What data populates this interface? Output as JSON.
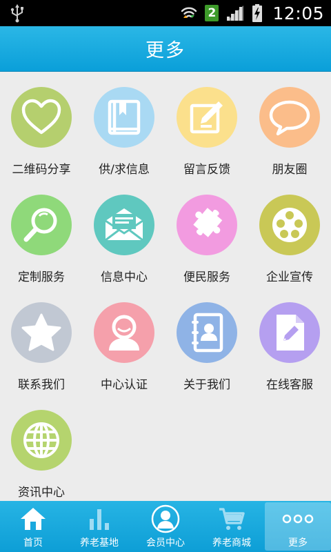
{
  "statusbar": {
    "sim_slot": "2",
    "time": "12:05",
    "icons": [
      "usb-icon",
      "wifi-icon",
      "sim-icon",
      "signal-icon",
      "battery-charging-icon"
    ]
  },
  "header": {
    "title": "更多"
  },
  "grid": {
    "items": [
      {
        "label": "二维码分享",
        "icon": "heart-icon",
        "color": "#b5cf6e"
      },
      {
        "label": "供/求信息",
        "icon": "book-icon",
        "color": "#a9d9f3"
      },
      {
        "label": "留言反馈",
        "icon": "edit-note-icon",
        "color": "#fbe08c"
      },
      {
        "label": "朋友圈",
        "icon": "speech-bubble-icon",
        "color": "#fbbd8a"
      },
      {
        "label": "定制服务",
        "icon": "magnifier-icon",
        "color": "#8fd97a"
      },
      {
        "label": "信息中心",
        "icon": "envelope-icon",
        "color": "#5fc8bf"
      },
      {
        "label": "便民服务",
        "icon": "puzzle-icon",
        "color": "#f29be0"
      },
      {
        "label": "企业宣传",
        "icon": "film-reel-icon",
        "color": "#c9c856"
      },
      {
        "label": "联系我们",
        "icon": "star-icon",
        "color": "#c1c8d3"
      },
      {
        "label": "中心认证",
        "icon": "user-icon",
        "color": "#f5a0ab"
      },
      {
        "label": "关于我们",
        "icon": "contacts-book-icon",
        "color": "#8fb3e6"
      },
      {
        "label": "在线客服",
        "icon": "document-edit-icon",
        "color": "#b59ff0"
      },
      {
        "label": "资讯中心",
        "icon": "globe-icon",
        "color": "#b5d46e"
      }
    ]
  },
  "bottomnav": {
    "tabs": [
      {
        "label": "首页",
        "icon": "home-icon"
      },
      {
        "label": "养老基地",
        "icon": "bar-chart-icon"
      },
      {
        "label": "会员中心",
        "icon": "member-avatar-icon"
      },
      {
        "label": "养老商城",
        "icon": "cart-icon"
      },
      {
        "label": "更多",
        "icon": "more-dots-icon"
      }
    ],
    "active_index": 4
  }
}
